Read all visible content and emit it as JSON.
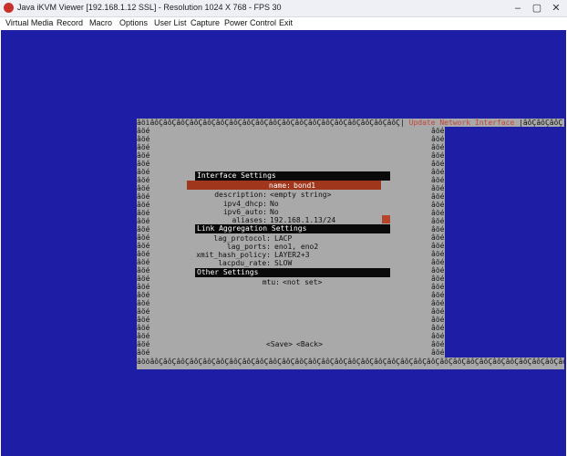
{
  "window": {
    "title": "Java iKVM Viewer  [192.168.1.12 SSL]  - Resolution 1024 X 768 - FPS 30",
    "minimize": "–",
    "maximize": "▢",
    "close": "✕"
  },
  "menu": [
    "Virtual Media",
    "Record",
    "Macro",
    "Options",
    "User List",
    "Capture",
    "Power Control",
    "Exit"
  ],
  "dialog": {
    "border_top_left": "âöìâôÇâôÇâôÇâôÇâôÇâôÇâôÇâôÇâôÇâôÇâôÇâôÇâôÇâôÇâôÇâôÇâôÇâôÇâôÇ|",
    "title": " Update Network Interface ",
    "border_top_right": "|âôÇâôÇâôÇ",
    "border_bottom": "âööâôÇâôÇâôÇâôÇâôÇâôÇâôÇâôÇâôÇâôÇâôÇâôÇâôÇâôÇâôÇâôÇâôÇâôÇâôÇâôÇâôÇâôÇâôÇâôÇâôÇâôÇâôÇâôÇâôÇâôÇâôÇâôÇâôÇâôÇâôÇâôÇ",
    "edge_glyph": "âöé",
    "sections": {
      "interface": "Interface Settings",
      "lag": "Link Aggregation Settings",
      "other": "Other Settings"
    },
    "fields": {
      "name": {
        "label": "name:",
        "value": "bond1"
      },
      "description": {
        "label": "description:",
        "value": "<empty string>"
      },
      "ipv4_dhcp": {
        "label": "ipv4_dhcp:",
        "value": "No"
      },
      "ipv6_auto": {
        "label": "ipv6_auto:",
        "value": "No"
      },
      "aliases": {
        "label": "aliases:",
        "value": "192.168.1.13/24"
      },
      "lag_protocol": {
        "label": "lag_protocol:",
        "value": "LACP"
      },
      "lag_ports": {
        "label": "lag_ports:",
        "value": "eno1, eno2"
      },
      "xmit_hash_policy": {
        "label": "xmit_hash_policy:",
        "value": "LAYER2+3"
      },
      "lacpdu_rate": {
        "label": "lacpdu_rate:",
        "value": "SLOW"
      },
      "mtu": {
        "label": "mtu:",
        "value": "<not set>"
      }
    },
    "save": "<Save>",
    "back": "<Back>"
  },
  "colors": {
    "screen_bg": "#1d1da6",
    "dialog_bg": "#a9a9a9",
    "selection": "#a0361c",
    "title_red": "#c4443a"
  }
}
